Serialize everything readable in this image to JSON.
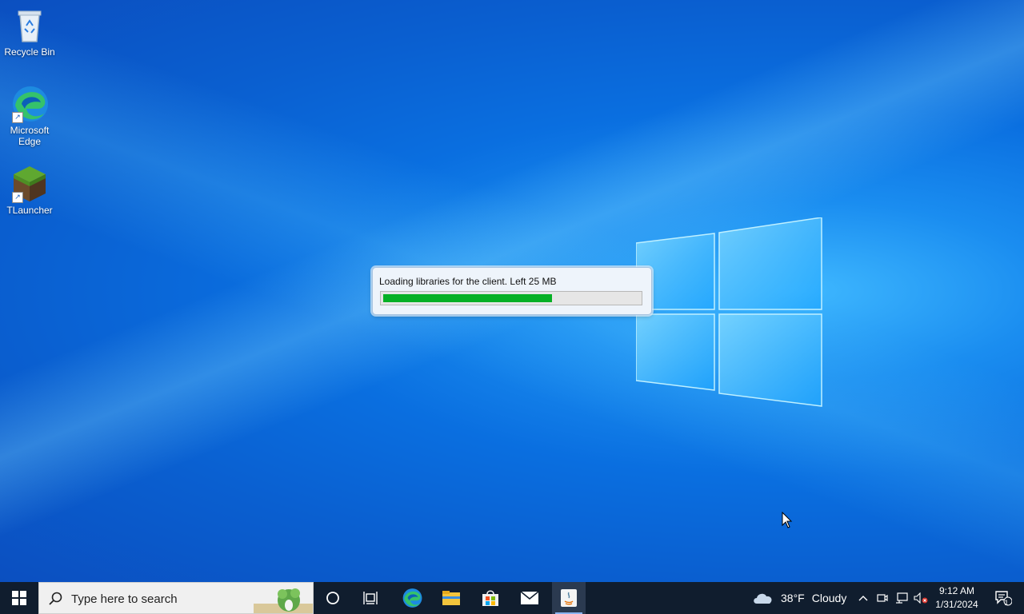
{
  "desktop": {
    "icons": [
      {
        "label": "Recycle Bin"
      },
      {
        "label": "Microsoft Edge"
      },
      {
        "label": "TLauncher"
      }
    ]
  },
  "loader": {
    "message": "Loading libraries for the client. Left 25 MB",
    "progress_fraction": 0.66,
    "progress_color": "#06b025"
  },
  "taskbar": {
    "start_icon": "windows-logo-icon",
    "search_placeholder": "Type here to search",
    "pinned": [
      {
        "name": "cortana-icon"
      },
      {
        "name": "task-view-icon"
      },
      {
        "name": "edge-icon"
      },
      {
        "name": "file-explorer-icon"
      },
      {
        "name": "microsoft-store-icon"
      },
      {
        "name": "mail-icon"
      },
      {
        "name": "java-icon",
        "active": true
      }
    ],
    "weather": {
      "temp": "38°F",
      "condition": "Cloudy"
    },
    "clock": {
      "time": "9:12 AM",
      "date": "1/31/2024"
    },
    "notification_count": "1"
  },
  "colors": {
    "taskbar": "#101d2e",
    "desktop_accent": "#0a6fe0"
  }
}
